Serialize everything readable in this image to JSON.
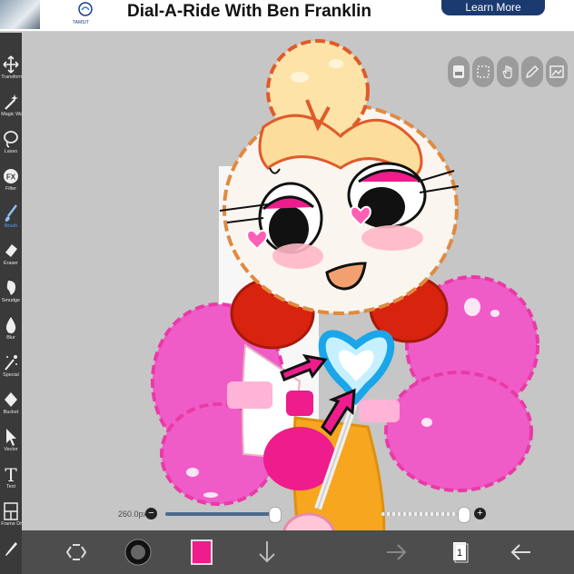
{
  "ad": {
    "logo_text": "TAMSIT",
    "headline": "Dial-A-Ride With Ben Franklin",
    "cta": "Learn More"
  },
  "toolbar": {
    "items": [
      {
        "label": "Transform",
        "icon": "move-arrows-icon"
      },
      {
        "label": "Magic Wand",
        "icon": "magic-wand-icon"
      },
      {
        "label": "Lasso",
        "icon": "lasso-icon"
      },
      {
        "label": "Filter",
        "icon": "fx-icon",
        "glyph": "FX"
      },
      {
        "label": "Brush",
        "icon": "brush-icon",
        "active": true
      },
      {
        "label": "Eraser",
        "icon": "eraser-icon"
      },
      {
        "label": "Smudge",
        "icon": "smudge-icon"
      },
      {
        "label": "Blur",
        "icon": "blur-drop-icon"
      },
      {
        "label": "Special",
        "icon": "special-wand-icon"
      },
      {
        "label": "Bucket",
        "icon": "bucket-icon"
      },
      {
        "label": "Vector",
        "icon": "vector-cursor-icon"
      },
      {
        "label": "Text",
        "icon": "text-icon",
        "glyph": "T"
      },
      {
        "label": "Frame Divider",
        "icon": "frame-divider-icon"
      },
      {
        "label": "",
        "icon": "eyedropper-icon"
      }
    ],
    "active_color": "#5aa0ff"
  },
  "actions": [
    "record-icon",
    "selection-icon",
    "hand-icon",
    "pencil-icon",
    "image-icon"
  ],
  "slider": {
    "size_label": "260.0px",
    "minus": "−",
    "plus": "+",
    "size_fraction": 0.95,
    "opacity_fraction": 0.92
  },
  "bottombar": {
    "layer_count": "1",
    "current_color": "#ee1c8c",
    "icons": [
      "recycle-arrows-icon",
      "brush-preview-icon",
      "color-swatch-icon",
      "download-arrow-icon",
      "forward-arrow-icon",
      "layers-icon",
      "back-arrow-icon"
    ]
  },
  "colors": {
    "toolbar_bg": "#3a3a3a",
    "canvas_bg": "#c6c6c6",
    "bottombar_bg": "#4d4d4d",
    "ad_button": "#1b3a6f"
  }
}
